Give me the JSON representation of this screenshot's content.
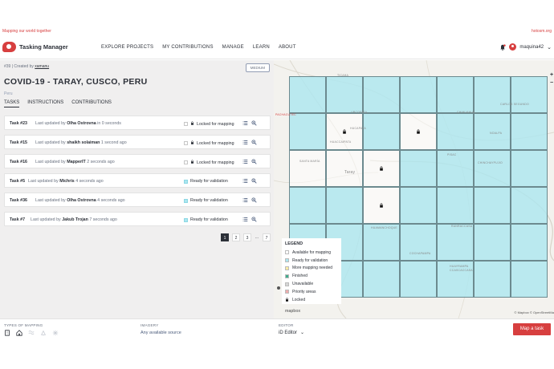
{
  "top_strip": {
    "left_text": "Mapping our world together",
    "right_text": "hotosm.org"
  },
  "header": {
    "logo_text": "Tasking Manager",
    "nav": [
      "EXPLORE PROJECTS",
      "MY CONTRIBUTIONS",
      "MANAGE",
      "LEARN",
      "ABOUT"
    ],
    "username": "maquina42",
    "icons": {
      "notifications": "bell-icon",
      "avatar": "user-avatar",
      "menu": "chevron-down-icon"
    }
  },
  "project": {
    "crumb_id": "#39",
    "crumb_created": "| Created by",
    "crumb_author": "xamanu",
    "difficulty": "MEDIUM",
    "title": "COVID-19 - TARAY, CUSCO, PERU",
    "organisation": "Peru",
    "tabs": [
      "TASKS",
      "INSTRUCTIONS",
      "CONTRIBUTIONS"
    ]
  },
  "tasks": [
    {
      "id": "Task #23",
      "prefix": "Last updated by",
      "user": "Olha Ostrovna",
      "time": "in 0 seconds",
      "status": "Locked for mapping",
      "status_type": "locked"
    },
    {
      "id": "Task #15",
      "prefix": "Last updated by",
      "user": "shaikh solaiman",
      "time": "1 second ago",
      "status": "Locked for mapping",
      "status_type": "locked"
    },
    {
      "id": "Task #16",
      "prefix": "Last updated by",
      "user": "MapperIT",
      "time": "2 seconds ago",
      "status": "Locked for mapping",
      "status_type": "locked"
    },
    {
      "id": "Task #5",
      "prefix": "Last updated by",
      "user": "Michris",
      "time": "4 seconds ago",
      "status": "Ready for validation",
      "status_type": "validation"
    },
    {
      "id": "Task #36",
      "prefix": "Last updated by",
      "user": "Olha Ostrovna",
      "time": "4 seconds ago",
      "status": "Ready for validation",
      "status_type": "validation"
    },
    {
      "id": "Task #7",
      "prefix": "Last updated by",
      "user": "Jakub Trojan",
      "time": "7 seconds ago",
      "status": "Ready for validation",
      "status_type": "validation"
    }
  ],
  "pagination": [
    "1",
    "2",
    "3",
    "...",
    "7"
  ],
  "pagination_active": "1",
  "map": {
    "places": [
      "TICAHA",
      "PACHACUTEC",
      "URCOPATA",
      "HUCAPATA",
      "CHIHUAHUA",
      "CARLOS SEGUNDO",
      "HUACCAIPATA",
      "NOALPA",
      "SANTA MARÍA",
      "PISAC",
      "CHINCHAYPUJIO",
      "HUAMANCHOQUE",
      "RANRACCASA",
      "Taray",
      "CCASCACCASA",
      "COCHAPAMPA",
      "HUAYRAMPA"
    ],
    "legend_title": "LEGEND",
    "legend": [
      {
        "label": "Available for mapping",
        "color": "#ffffff"
      },
      {
        "label": "Ready for validation",
        "color": "#ade6ef"
      },
      {
        "label": "More mapping needed",
        "color": "#fceca4"
      },
      {
        "label": "Finished",
        "color": "#40ac8c"
      },
      {
        "label": "Unavailable",
        "color": "#d6d6d6"
      },
      {
        "label": "Priority areas",
        "color": "#efadad"
      },
      {
        "label": "Locked",
        "color": "lock-icon"
      }
    ],
    "mapbox": "mapbox",
    "attribution": "© Mapbox © OpenStreetMa",
    "zoom_in": "+",
    "zoom_out": "−"
  },
  "footer": {
    "types_label": "TYPES OF MAPPING",
    "imagery_label": "IMAGERY",
    "imagery_value": "Any available source",
    "editor_label": "EDITOR",
    "editor_value": "iD Editor",
    "map_button": "Map a task"
  },
  "colors": {
    "accent": "#d73f3f",
    "validation": "#ade6ef",
    "text": "#2c3038"
  }
}
